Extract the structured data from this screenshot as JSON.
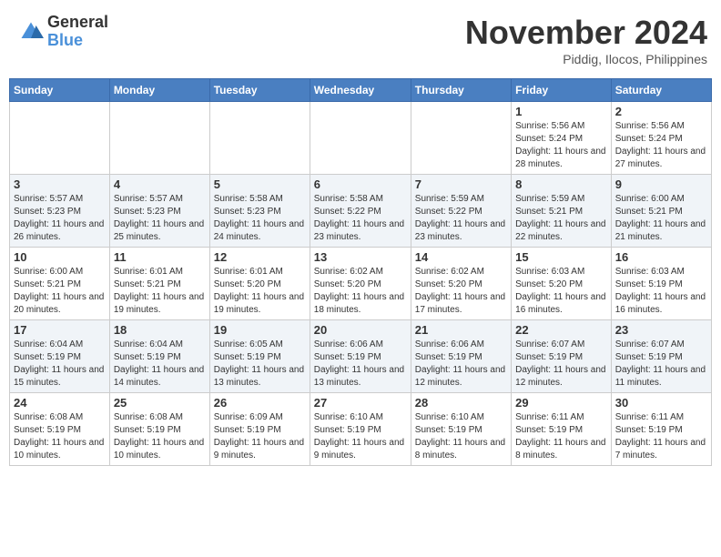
{
  "header": {
    "logo_general": "General",
    "logo_blue": "Blue",
    "month_title": "November 2024",
    "location": "Piddig, Ilocos, Philippines"
  },
  "weekdays": [
    "Sunday",
    "Monday",
    "Tuesday",
    "Wednesday",
    "Thursday",
    "Friday",
    "Saturday"
  ],
  "weeks": [
    [
      {
        "day": "",
        "info": ""
      },
      {
        "day": "",
        "info": ""
      },
      {
        "day": "",
        "info": ""
      },
      {
        "day": "",
        "info": ""
      },
      {
        "day": "",
        "info": ""
      },
      {
        "day": "1",
        "info": "Sunrise: 5:56 AM\nSunset: 5:24 PM\nDaylight: 11 hours and 28 minutes."
      },
      {
        "day": "2",
        "info": "Sunrise: 5:56 AM\nSunset: 5:24 PM\nDaylight: 11 hours and 27 minutes."
      }
    ],
    [
      {
        "day": "3",
        "info": "Sunrise: 5:57 AM\nSunset: 5:23 PM\nDaylight: 11 hours and 26 minutes."
      },
      {
        "day": "4",
        "info": "Sunrise: 5:57 AM\nSunset: 5:23 PM\nDaylight: 11 hours and 25 minutes."
      },
      {
        "day": "5",
        "info": "Sunrise: 5:58 AM\nSunset: 5:23 PM\nDaylight: 11 hours and 24 minutes."
      },
      {
        "day": "6",
        "info": "Sunrise: 5:58 AM\nSunset: 5:22 PM\nDaylight: 11 hours and 23 minutes."
      },
      {
        "day": "7",
        "info": "Sunrise: 5:59 AM\nSunset: 5:22 PM\nDaylight: 11 hours and 23 minutes."
      },
      {
        "day": "8",
        "info": "Sunrise: 5:59 AM\nSunset: 5:21 PM\nDaylight: 11 hours and 22 minutes."
      },
      {
        "day": "9",
        "info": "Sunrise: 6:00 AM\nSunset: 5:21 PM\nDaylight: 11 hours and 21 minutes."
      }
    ],
    [
      {
        "day": "10",
        "info": "Sunrise: 6:00 AM\nSunset: 5:21 PM\nDaylight: 11 hours and 20 minutes."
      },
      {
        "day": "11",
        "info": "Sunrise: 6:01 AM\nSunset: 5:21 PM\nDaylight: 11 hours and 19 minutes."
      },
      {
        "day": "12",
        "info": "Sunrise: 6:01 AM\nSunset: 5:20 PM\nDaylight: 11 hours and 19 minutes."
      },
      {
        "day": "13",
        "info": "Sunrise: 6:02 AM\nSunset: 5:20 PM\nDaylight: 11 hours and 18 minutes."
      },
      {
        "day": "14",
        "info": "Sunrise: 6:02 AM\nSunset: 5:20 PM\nDaylight: 11 hours and 17 minutes."
      },
      {
        "day": "15",
        "info": "Sunrise: 6:03 AM\nSunset: 5:20 PM\nDaylight: 11 hours and 16 minutes."
      },
      {
        "day": "16",
        "info": "Sunrise: 6:03 AM\nSunset: 5:19 PM\nDaylight: 11 hours and 16 minutes."
      }
    ],
    [
      {
        "day": "17",
        "info": "Sunrise: 6:04 AM\nSunset: 5:19 PM\nDaylight: 11 hours and 15 minutes."
      },
      {
        "day": "18",
        "info": "Sunrise: 6:04 AM\nSunset: 5:19 PM\nDaylight: 11 hours and 14 minutes."
      },
      {
        "day": "19",
        "info": "Sunrise: 6:05 AM\nSunset: 5:19 PM\nDaylight: 11 hours and 13 minutes."
      },
      {
        "day": "20",
        "info": "Sunrise: 6:06 AM\nSunset: 5:19 PM\nDaylight: 11 hours and 13 minutes."
      },
      {
        "day": "21",
        "info": "Sunrise: 6:06 AM\nSunset: 5:19 PM\nDaylight: 11 hours and 12 minutes."
      },
      {
        "day": "22",
        "info": "Sunrise: 6:07 AM\nSunset: 5:19 PM\nDaylight: 11 hours and 12 minutes."
      },
      {
        "day": "23",
        "info": "Sunrise: 6:07 AM\nSunset: 5:19 PM\nDaylight: 11 hours and 11 minutes."
      }
    ],
    [
      {
        "day": "24",
        "info": "Sunrise: 6:08 AM\nSunset: 5:19 PM\nDaylight: 11 hours and 10 minutes."
      },
      {
        "day": "25",
        "info": "Sunrise: 6:08 AM\nSunset: 5:19 PM\nDaylight: 11 hours and 10 minutes."
      },
      {
        "day": "26",
        "info": "Sunrise: 6:09 AM\nSunset: 5:19 PM\nDaylight: 11 hours and 9 minutes."
      },
      {
        "day": "27",
        "info": "Sunrise: 6:10 AM\nSunset: 5:19 PM\nDaylight: 11 hours and 9 minutes."
      },
      {
        "day": "28",
        "info": "Sunrise: 6:10 AM\nSunset: 5:19 PM\nDaylight: 11 hours and 8 minutes."
      },
      {
        "day": "29",
        "info": "Sunrise: 6:11 AM\nSunset: 5:19 PM\nDaylight: 11 hours and 8 minutes."
      },
      {
        "day": "30",
        "info": "Sunrise: 6:11 AM\nSunset: 5:19 PM\nDaylight: 11 hours and 7 minutes."
      }
    ]
  ]
}
